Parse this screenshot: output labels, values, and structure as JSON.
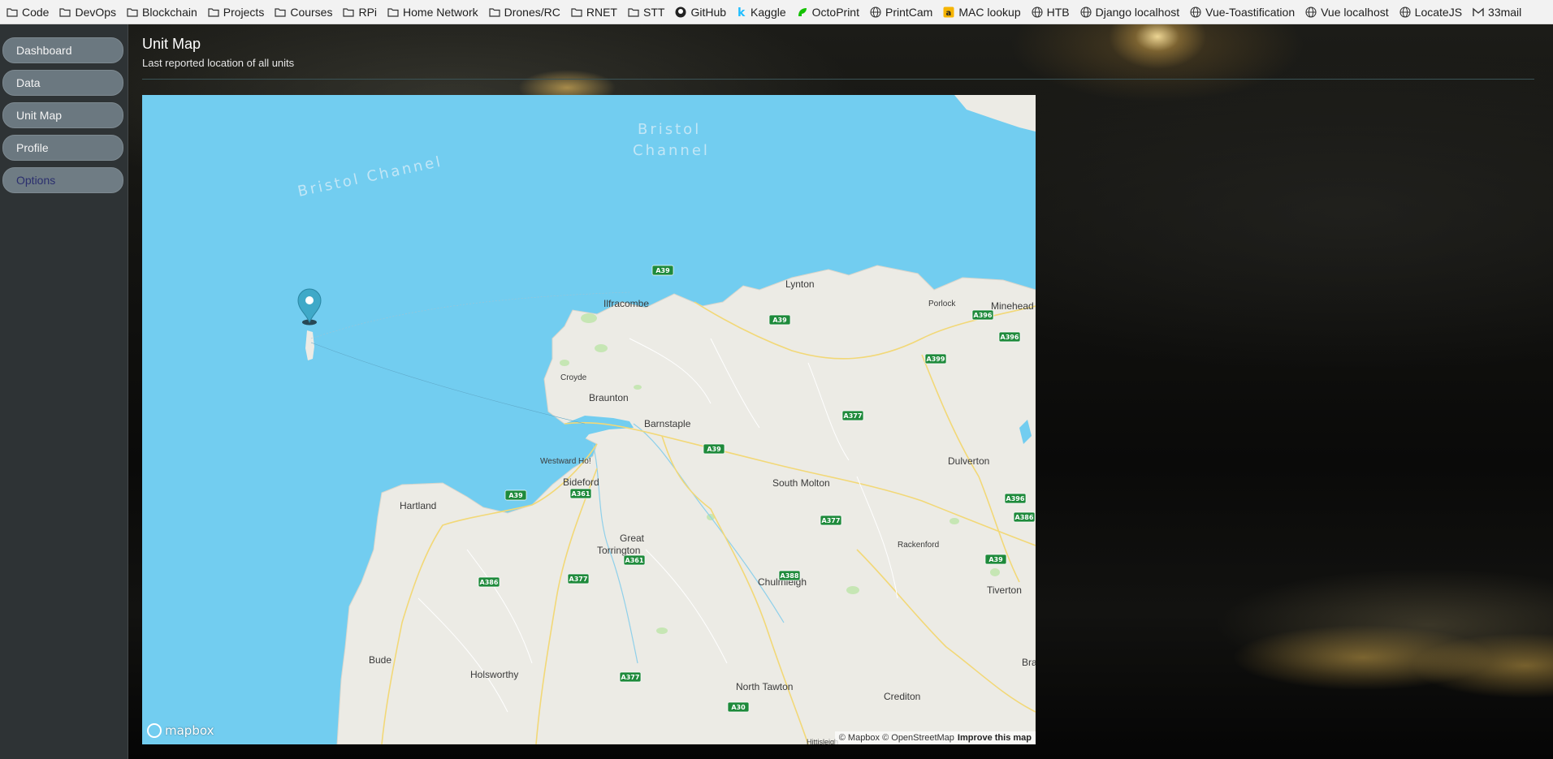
{
  "bookmarks": [
    {
      "label": "Code",
      "icon": "folder-icon"
    },
    {
      "label": "DevOps",
      "icon": "folder-icon"
    },
    {
      "label": "Blockchain",
      "icon": "folder-icon"
    },
    {
      "label": "Projects",
      "icon": "folder-icon"
    },
    {
      "label": "Courses",
      "icon": "folder-icon"
    },
    {
      "label": "RPi",
      "icon": "folder-icon"
    },
    {
      "label": "Home Network",
      "icon": "folder-icon"
    },
    {
      "label": "Drones/RC",
      "icon": "folder-icon"
    },
    {
      "label": "RNET",
      "icon": "folder-icon"
    },
    {
      "label": "STT",
      "icon": "folder-icon"
    },
    {
      "label": "GitHub",
      "icon": "github-icon"
    },
    {
      "label": "Kaggle",
      "icon": "kaggle-icon"
    },
    {
      "label": "OctoPrint",
      "icon": "octoprint-icon"
    },
    {
      "label": "PrintCam",
      "icon": "globe-icon"
    },
    {
      "label": "MAC lookup",
      "icon": "mac-lookup-icon"
    },
    {
      "label": "HTB",
      "icon": "globe-icon"
    },
    {
      "label": "Django localhost",
      "icon": "globe-icon"
    },
    {
      "label": "Vue-Toastification",
      "icon": "globe-icon"
    },
    {
      "label": "Vue localhost",
      "icon": "globe-icon"
    },
    {
      "label": "LocateJS",
      "icon": "globe-icon"
    },
    {
      "label": "33mail",
      "icon": "33mail-icon"
    }
  ],
  "sidebar": {
    "items": [
      {
        "label": "Dashboard"
      },
      {
        "label": "Data"
      },
      {
        "label": "Unit Map"
      },
      {
        "label": "Profile"
      },
      {
        "label": "Options"
      }
    ]
  },
  "page": {
    "title": "Unit Map",
    "subtitle": "Last reported location of all units"
  },
  "map": {
    "water_labels": [
      "Bristol Channel",
      "Bristol",
      "Channel"
    ],
    "places": [
      "Lynton",
      "Ilfracombe",
      "Porlock",
      "Minehead",
      "Croyde",
      "Braunton",
      "Barnstaple",
      "Westward Ho!",
      "Bideford",
      "South Molton",
      "Dulverton",
      "Hartland",
      "Great",
      "Torrington",
      "Rackenford",
      "Chulmleigh",
      "Tiverton",
      "Bude",
      "Holsworthy",
      "North Tawton",
      "Crediton",
      "Bra",
      "Hittisleigh"
    ],
    "roads": [
      "A39",
      "A39",
      "A396",
      "A396",
      "A399",
      "A377",
      "A39",
      "A39",
      "A361",
      "A396",
      "A377",
      "A386",
      "A388",
      "A361",
      "A377",
      "A39",
      "A386",
      "A377",
      "A30"
    ],
    "logo": "mapbox",
    "attribution": "© Mapbox © OpenStreetMap",
    "improve": "Improve this map"
  }
}
